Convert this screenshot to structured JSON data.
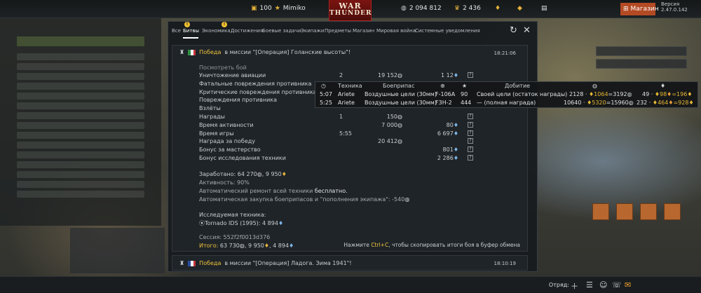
{
  "topbar": {
    "gold_amount": "100",
    "username": "Mimiko",
    "logo_line1": "WAR",
    "logo_line2": "THUNDER",
    "silver_amount": "2 094 812",
    "rp_amount": "2 436",
    "shop_label": "Магазин",
    "version": "Версия 2.47.0.142"
  },
  "dialog": {
    "tabs": [
      {
        "label": "Все"
      },
      {
        "label": "Битвы"
      },
      {
        "label": "Экономика"
      },
      {
        "label": "Достижения"
      },
      {
        "label": "Боевые задачи"
      },
      {
        "label": "Экипажи"
      },
      {
        "label": "Предметы"
      },
      {
        "label": "Магазин"
      },
      {
        "label": "Мировая война"
      },
      {
        "label": "Системные уведомления"
      }
    ],
    "badge": "!"
  },
  "message1": {
    "victory": "Победа",
    "mission_text": "в миссии \"[Операция] Голанские высоты\"!",
    "time": "18:21:06",
    "view_battle": "Посмотреть бой",
    "rows": [
      {
        "label": "Уничтожение авиации",
        "count": "2",
        "silver": "19 152",
        "rp": "1 12"
      },
      {
        "label": "Фатальные повреждения противника",
        "count": "",
        "silver": "",
        "rp": ""
      },
      {
        "label": "Критические повреждения противника",
        "count": "",
        "silver": "",
        "rp": ""
      },
      {
        "label": "Повреждения противника",
        "count": "",
        "silver": "",
        "rp": ""
      },
      {
        "label": "Взлёты",
        "count": "",
        "silver": "",
        "rp": ""
      },
      {
        "label": "Награды",
        "count": "1",
        "silver": "150",
        "rp": ""
      },
      {
        "label": "Время активности",
        "count": "",
        "silver": "7 000",
        "rp": "80"
      },
      {
        "label": "Время игры",
        "count": "5:55",
        "silver": "",
        "rp": "6 697"
      },
      {
        "label": "Награда за победу",
        "count": "",
        "silver": "20 412",
        "rp": ""
      },
      {
        "label": "Бонус за мастерство",
        "count": "",
        "silver": "",
        "rp": "801"
      },
      {
        "label": "Бонус исследования техники",
        "count": "",
        "silver": "",
        "rp": "2 286"
      }
    ],
    "earned_label": "Заработано:",
    "earned_silver": "64 270",
    "earned_rp": "9 950",
    "activity": "Активность: 90%",
    "auto_repair_prefix": "Автоматический ремонт всей техники",
    "auto_repair_value": "бесплатно.",
    "auto_purchase": "Автоматическая закупка боеприпасов и \"пополнения экипажа\": -540",
    "research_label": "Исследуемая техника:",
    "research_vehicle": "Tornado IDS (1995): 4 894",
    "session": "Сессия: 552f2f0013d376",
    "total_label": "Итого:",
    "total_value": "63 730",
    "total_rp": "9 950",
    "total_rp2": "4 894",
    "copy_hint_prefix": "Нажмите",
    "copy_hint_key": "Ctrl+C",
    "copy_hint_suffix": ", чтобы скопировать итоги боя в буфер обмена"
  },
  "message2": {
    "victory": "Победа",
    "mission_text": "в миссии \"[Операция] Ладога. Зима 1941\"!",
    "time": "18:10:19"
  },
  "tooltip": {
    "header": {
      "vehicle": "Техника",
      "ammo": "Боеприпас",
      "reward": "Добитие"
    },
    "rows": [
      {
        "time": "5:07",
        "vehicle": "Ariete",
        "ammo": "Воздушные цели (30мм)",
        "target": "F-106A",
        "score": "90",
        "reward": "Своей цели (остаток награды)",
        "silver_calc": "2128 · ",
        "silver_mul": "1064",
        "silver_res": "=3192",
        "rp_calc": "49 · ",
        "rp_mul": "98",
        "rp_res": "=196"
      },
      {
        "time": "5:25",
        "vehicle": "Ariete",
        "ammo": "Воздушные цели (30мм)",
        "target": "F3H-2",
        "score": "444",
        "reward": "— (полная награда)",
        "silver_calc": "10640 · ",
        "silver_mul": "5320",
        "silver_res": "=15960",
        "rp_calc": "232 · ",
        "rp_mul": "464",
        "rp_res": "=928"
      }
    ]
  },
  "bottombar": {
    "squad_label": "Отряд:"
  },
  "icons": {
    "gold_color": "#e4b23a",
    "accent_red": "#b44a24",
    "victory_color": "#f0c33c"
  }
}
